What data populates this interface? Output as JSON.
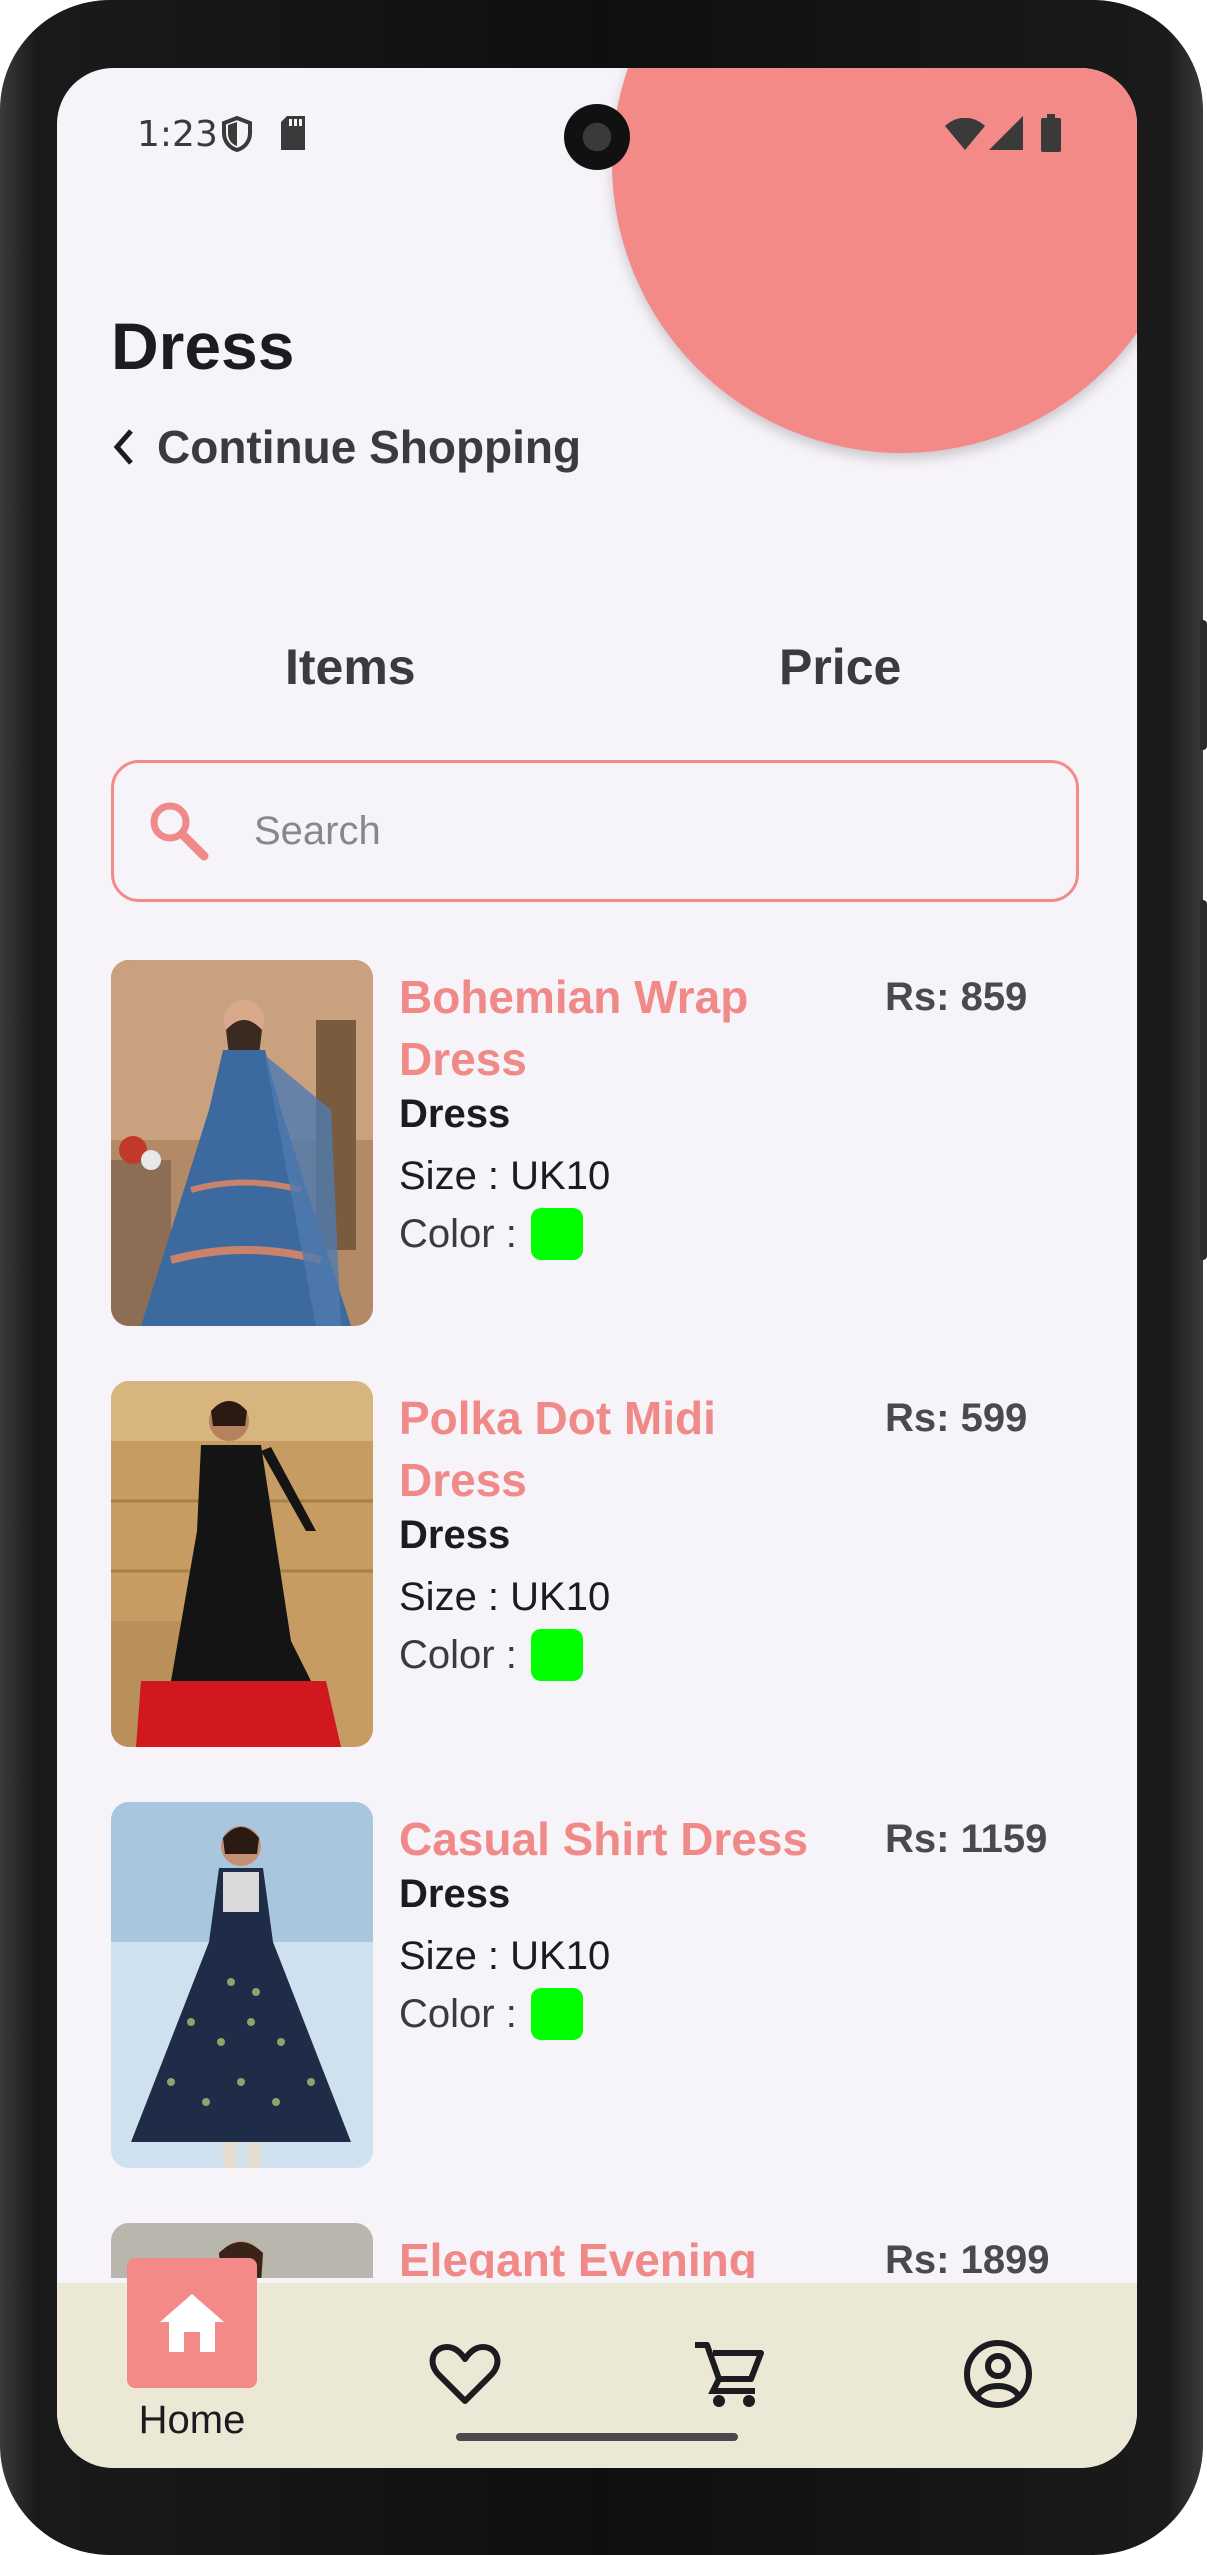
{
  "status_bar": {
    "time": "1:23"
  },
  "header": {
    "title": "Dress",
    "back_label": "Continue Shopping"
  },
  "tabs": [
    {
      "label": "Items"
    },
    {
      "label": "Price"
    }
  ],
  "search": {
    "placeholder": "Search",
    "value": ""
  },
  "products": [
    {
      "name": "Bohemian Wrap Dress",
      "price": "Rs: 859",
      "category": "Dress",
      "size": "Size : UK10",
      "color_label": "Color :",
      "color_hex": "#00ff00"
    },
    {
      "name": "Polka Dot Midi Dress",
      "price": "Rs: 599",
      "category": "Dress",
      "size": "Size : UK10",
      "color_label": "Color :",
      "color_hex": "#00ff00"
    },
    {
      "name": "Casual Shirt Dress",
      "price": "Rs: 1159",
      "category": "Dress",
      "size": "Size : UK10",
      "color_label": "Color :",
      "color_hex": "#00ff00"
    },
    {
      "name": "Elegant Evening",
      "price": "Rs: 1899"
    }
  ],
  "bottom_nav": {
    "items": [
      {
        "label": "Home",
        "icon": "home-icon",
        "active": true
      },
      {
        "icon": "heart-icon"
      },
      {
        "icon": "cart-icon"
      },
      {
        "icon": "account-icon"
      }
    ]
  },
  "colors": {
    "accent": "#f48a88",
    "background": "#f6f3f9",
    "nav_background": "#ece8d6"
  }
}
